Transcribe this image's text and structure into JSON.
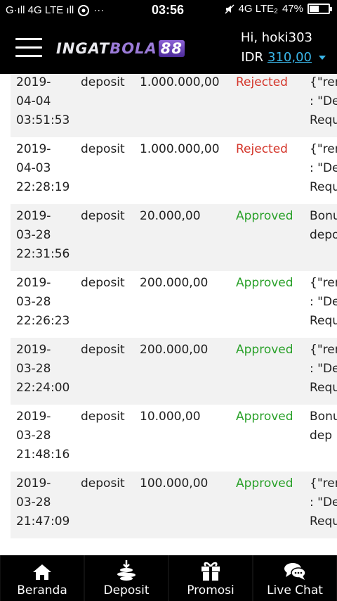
{
  "status_bar": {
    "left": "G·ıll 4G LTE ıll",
    "time": "03:56",
    "network": "4G LTE₂",
    "battery": "47%",
    "battery_level": 0.47
  },
  "header": {
    "logo": {
      "part1": "INGAT",
      "part2": "BOLA",
      "part3": "88"
    },
    "greeting": "Hi, hoki303",
    "currency": "IDR",
    "balance": "310,00"
  },
  "transactions": [
    {
      "date": [
        "2019-",
        "04-04",
        "03:51:53"
      ],
      "type": "deposit",
      "amount": "1.000.000,00",
      "status": "Rejected",
      "status_kind": "rejected",
      "remark": [
        "{\"rem",
        ": \"De",
        "Requ"
      ]
    },
    {
      "date": [
        "2019-",
        "04-03",
        "22:28:19"
      ],
      "type": "deposit",
      "amount": "1.000.000,00",
      "status": "Rejected",
      "status_kind": "rejected",
      "remark": [
        "{\"rem",
        ": \"De",
        "Requ"
      ]
    },
    {
      "date": [
        "2019-",
        "03-28",
        "22:31:56"
      ],
      "type": "deposit",
      "amount": "20.000,00",
      "status": "Approved",
      "status_kind": "approved",
      "remark": [
        "Bonu",
        "depo",
        ""
      ]
    },
    {
      "date": [
        "2019-",
        "03-28",
        "22:26:23"
      ],
      "type": "deposit",
      "amount": "200.000,00",
      "status": "Approved",
      "status_kind": "approved",
      "remark": [
        "{\"rem",
        ": \"De",
        "Requ"
      ]
    },
    {
      "date": [
        "2019-",
        "03-28",
        "22:24:00"
      ],
      "type": "deposit",
      "amount": "200.000,00",
      "status": "Approved",
      "status_kind": "approved",
      "remark": [
        "{\"rem",
        ": \"De",
        "Requ"
      ]
    },
    {
      "date": [
        "2019-",
        "03-28",
        "21:48:16"
      ],
      "type": "deposit",
      "amount": "10.000,00",
      "status": "Approved",
      "status_kind": "approved",
      "remark": [
        "Bonu",
        "dep",
        ""
      ]
    },
    {
      "date": [
        "2019-",
        "03-28",
        "21:47:09"
      ],
      "type": "deposit",
      "amount": "100.000,00",
      "status": "Approved",
      "status_kind": "approved",
      "remark": [
        "{\"rem",
        ": \"De",
        "Requ"
      ]
    }
  ],
  "bottom_nav": [
    {
      "label": "Beranda",
      "icon": "home-icon"
    },
    {
      "label": "Deposit",
      "icon": "deposit-coins-icon"
    },
    {
      "label": "Promosi",
      "icon": "gift-icon"
    },
    {
      "label": "Live Chat",
      "icon": "chat-icon"
    }
  ],
  "colors": {
    "header_bg": "#000000",
    "balance_link": "#3ab6e8",
    "rejected": "#d4352a",
    "approved": "#2aa12a",
    "row_shade": "#f2f2f2"
  }
}
